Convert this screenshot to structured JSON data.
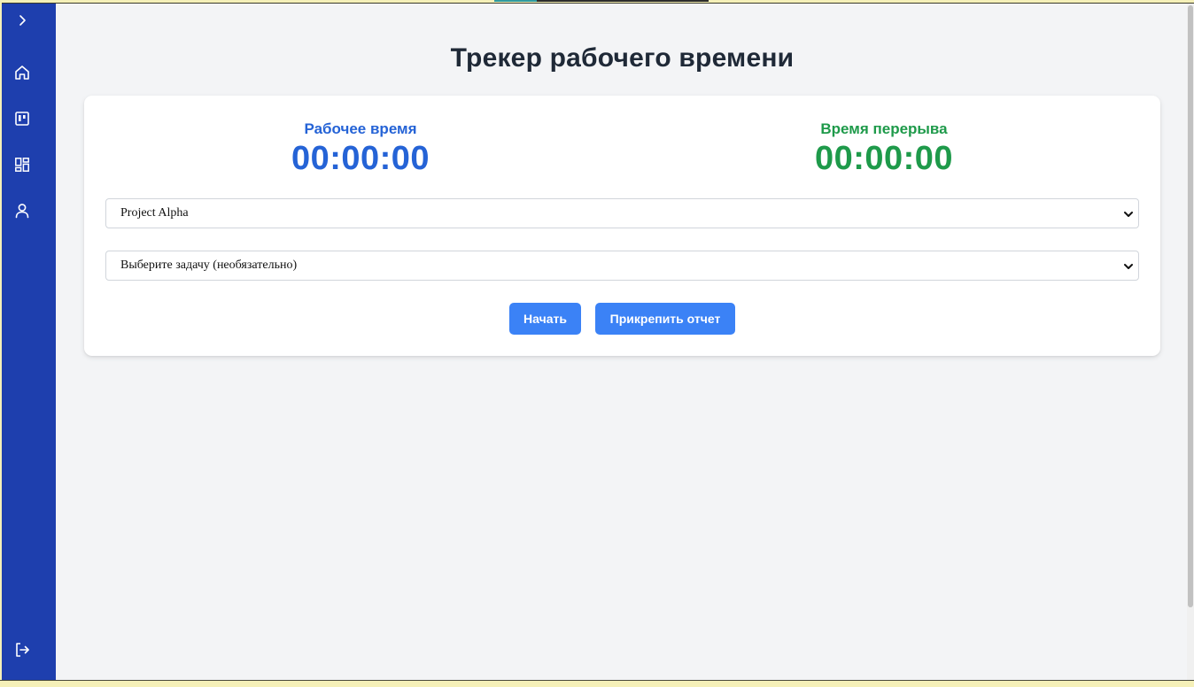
{
  "app": {
    "title": "Трекер рабочего времени"
  },
  "sidebar": {
    "items": [
      {
        "id": "expand",
        "icon": "chevron-right-icon"
      },
      {
        "id": "home",
        "icon": "home-icon"
      },
      {
        "id": "board",
        "icon": "kanban-board-icon"
      },
      {
        "id": "dashboard",
        "icon": "dashboard-grid-icon"
      },
      {
        "id": "profile",
        "icon": "user-icon"
      },
      {
        "id": "logout",
        "icon": "logout-icon"
      }
    ]
  },
  "timers": {
    "work": {
      "label": "Рабочее время",
      "value": "00:00:00",
      "color": "#2563d6"
    },
    "break": {
      "label": "Время перерыва",
      "value": "00:00:00",
      "color": "#1e9a4a"
    }
  },
  "form": {
    "project_select": {
      "selected": "Project Alpha"
    },
    "task_select": {
      "selected": "Выберите задачу (необязательно)"
    }
  },
  "actions": {
    "start_label": "Начать",
    "attach_report_label": "Прикрепить отчет"
  },
  "colors": {
    "sidebar": "#1e3fae",
    "accent": "#3b82f6",
    "background": "#f3f4f6"
  }
}
